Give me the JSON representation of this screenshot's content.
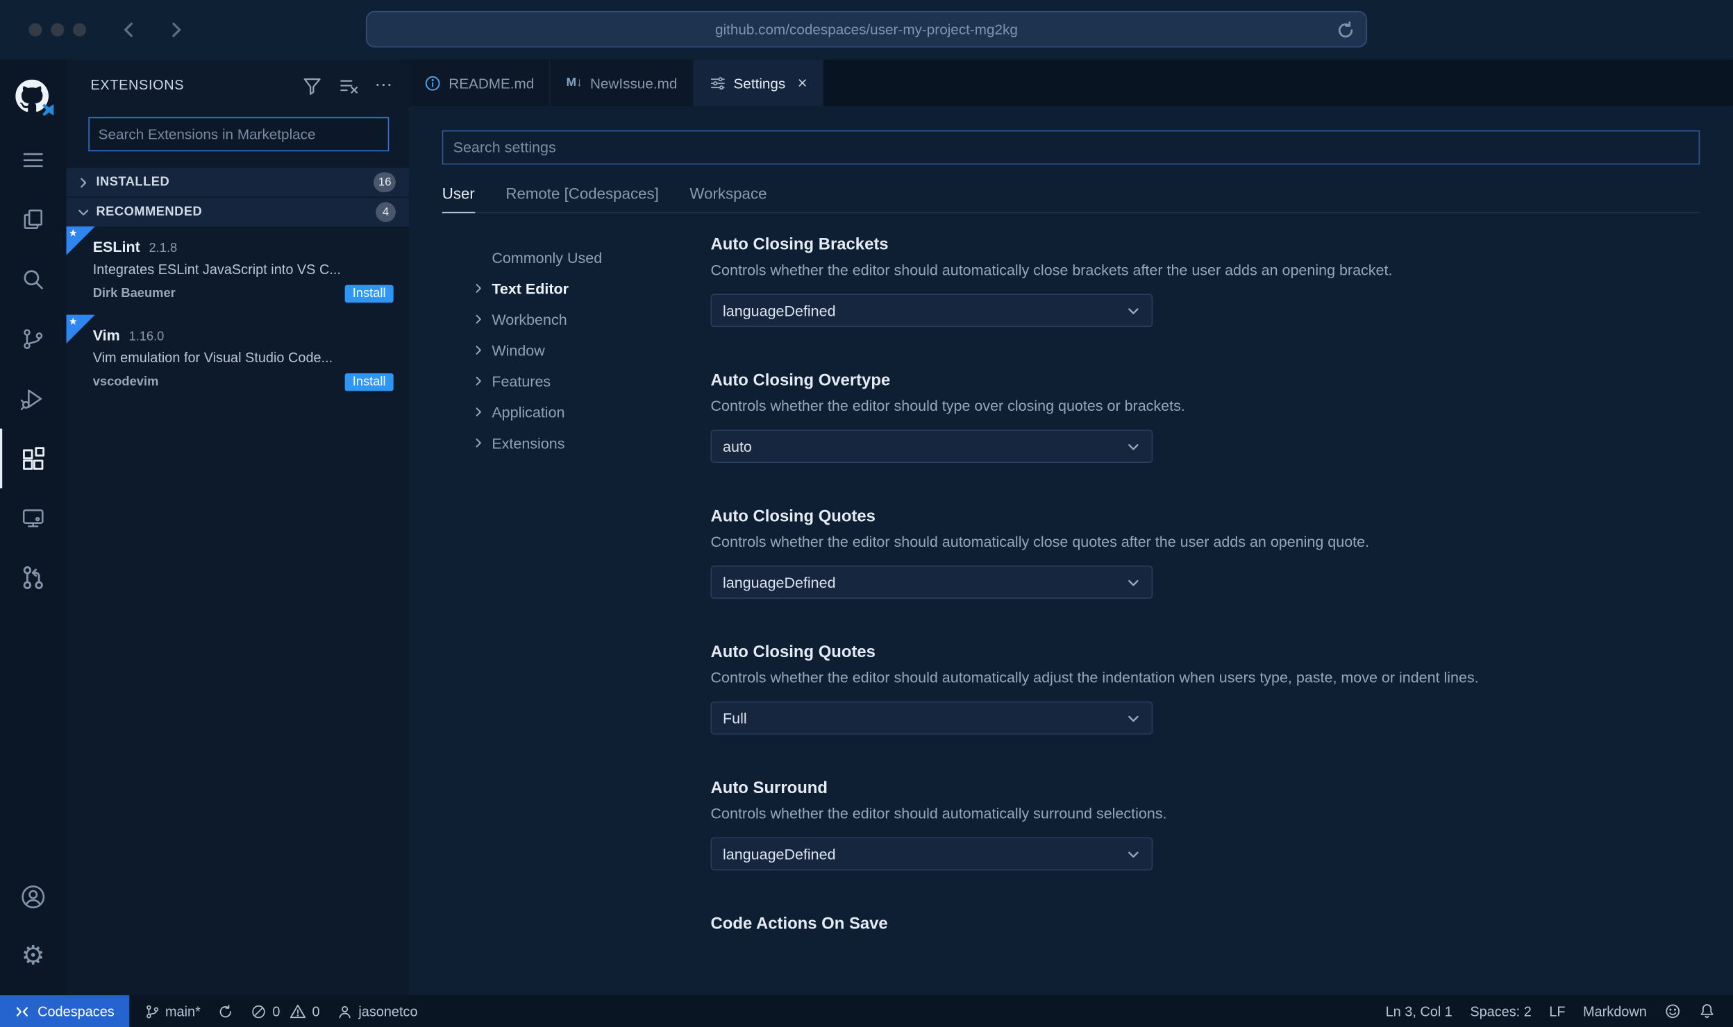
{
  "browser": {
    "url": "github.com/codespaces/user-my-project-mg2kg"
  },
  "activity_bar": {
    "icons": [
      "github-logo",
      "menu",
      "explorer",
      "search",
      "source-control",
      "run-debug",
      "extensions",
      "remote-explorer",
      "pull-request",
      "account",
      "settings-gear"
    ],
    "active": "extensions"
  },
  "sidebar": {
    "title": "EXTENSIONS",
    "search": {
      "placeholder": "Search Extensions in Marketplace",
      "value": ""
    },
    "sections": [
      {
        "label": "INSTALLED",
        "badge": "16"
      },
      {
        "label": "RECOMMENDED",
        "badge": "4"
      }
    ],
    "extensions": [
      {
        "name": "ESLint",
        "version": "2.1.8",
        "description": "Integrates ESLint JavaScript into VS C...",
        "author": "Dirk Baeumer",
        "action": "Install"
      },
      {
        "name": "Vim",
        "version": "1.16.0",
        "description": "Vim emulation for Visual Studio Code...",
        "author": "vscodevim",
        "action": "Install"
      }
    ]
  },
  "tabs": [
    {
      "label": "README.md"
    },
    {
      "label": "NewIssue.md",
      "icon_glyph": "M↓"
    },
    {
      "label": "Settings"
    }
  ],
  "settings_editor": {
    "search": {
      "placeholder": "Search settings",
      "value": ""
    },
    "scopes": [
      {
        "label": "User",
        "active": true
      },
      {
        "label": "Remote [Codespaces]",
        "active": false
      },
      {
        "label": "Workspace",
        "active": false
      }
    ],
    "toc": [
      "Commonly Used",
      "Text Editor",
      "Workbench",
      "Window",
      "Features",
      "Application",
      "Extensions"
    ],
    "items": [
      {
        "title": "Auto Closing Brackets",
        "description": "Controls whether the editor should automatically close brackets after the user adds an opening bracket.",
        "value": "languageDefined"
      },
      {
        "title": "Auto Closing Overtype",
        "description": "Controls whether the editor should type over closing quotes or brackets.",
        "value": "auto"
      },
      {
        "title": "Auto Closing Quotes",
        "description": "Controls whether the editor should automatically close quotes after the user adds an opening quote.",
        "value": "languageDefined"
      },
      {
        "title": "Auto Closing Quotes",
        "description": "Controls whether the editor should automatically adjust the indentation when users type, paste, move or indent lines.",
        "value": "Full"
      },
      {
        "title": "Auto Surround",
        "description": "Controls whether the editor should automatically surround selections.",
        "value": "languageDefined"
      },
      {
        "title": "Code Actions On Save",
        "description": "",
        "value": ""
      }
    ]
  },
  "status_bar": {
    "codespaces": "Codespaces",
    "branch": "main*",
    "errors": "0",
    "warnings": "0",
    "user": "jasonetco",
    "cursor": "Ln 3, Col 1",
    "indent": "Spaces: 2",
    "eol": "LF",
    "language": "Markdown"
  },
  "colors": {
    "accent": "#3794ff",
    "codespaces_blue": "#2564cf",
    "install_blue": "#2e96f5"
  }
}
